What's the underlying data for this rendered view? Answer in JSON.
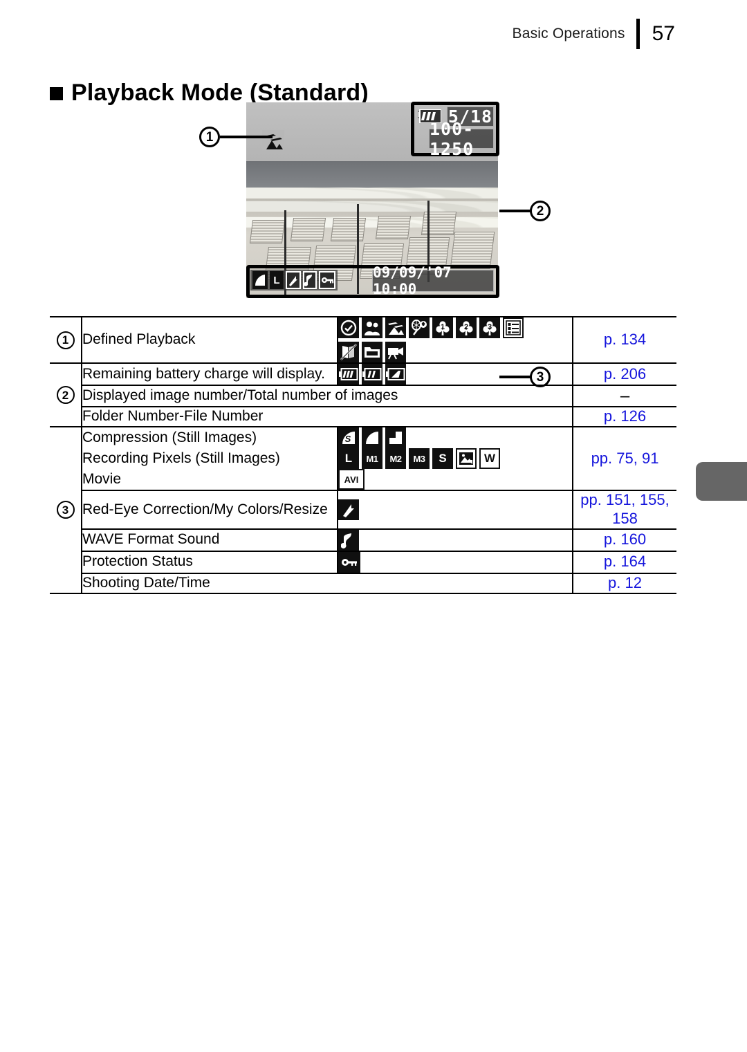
{
  "header": {
    "section": "Basic Operations",
    "page_number": "57"
  },
  "title": "Playback Mode (Standard)",
  "figure": {
    "callouts": [
      "1",
      "2",
      "3"
    ],
    "lcd": {
      "scene_icon": "landscape-scene-icon",
      "battery_icon": "battery-full-icon",
      "image_count": "5/18",
      "folder_file": "100-1250",
      "date_time": "09/09/'07  10:00",
      "status_icons": [
        "compression-fine-icon",
        "recording-pixels-large-icon",
        "red-eye-correction-icon",
        "wave-sound-icon",
        "protection-key-icon"
      ]
    }
  },
  "table": {
    "groups": [
      {
        "callout": "1",
        "rows": [
          {
            "desc": "Defined Playback",
            "icons": [
              {
                "name": "clock-check-icon",
                "label": ""
              },
              {
                "name": "people-portrait-icon",
                "label": ""
              },
              {
                "name": "landscape-icon",
                "label": ""
              },
              {
                "name": "sports-event-icon",
                "label": ""
              },
              {
                "name": "category-club-1-icon",
                "label": "1"
              },
              {
                "name": "category-club-2-icon",
                "label": "2"
              },
              {
                "name": "category-club-3-icon",
                "label": "3"
              },
              {
                "name": "checklist-icon",
                "label": ""
              },
              {
                "name": "no-photo-icon",
                "label": ""
              },
              {
                "name": "folder-icon",
                "label": ""
              },
              {
                "name": "movie-camera-icon",
                "label": ""
              }
            ],
            "page": "p. 134"
          }
        ]
      },
      {
        "callout": "2",
        "rows": [
          {
            "desc": "Remaining battery charge will display.",
            "icons": [
              {
                "name": "battery-full-icon",
                "label": ""
              },
              {
                "name": "battery-half-icon",
                "label": ""
              },
              {
                "name": "battery-low-icon",
                "label": ""
              }
            ],
            "page": "p. 206"
          },
          {
            "desc": "Displayed image number/Total number of images",
            "icons": [],
            "page": "–",
            "full_width": true
          },
          {
            "desc": "Folder Number-File Number",
            "icons": [],
            "page": "p. 126",
            "full_width": true
          }
        ]
      },
      {
        "callout": "3",
        "rows": [
          {
            "desc": "Compression (Still Images)",
            "icons": [
              {
                "name": "compression-superfine-icon",
                "label": "S"
              },
              {
                "name": "compression-fine-icon",
                "label": ""
              },
              {
                "name": "compression-normal-icon",
                "label": ""
              }
            ],
            "page": "pp. 75, 91",
            "page_rowspan": 3
          },
          {
            "desc": "Recording Pixels (Still Images)",
            "icons": [
              {
                "name": "pixels-large-icon",
                "label": "L"
              },
              {
                "name": "pixels-medium1-icon",
                "label": "M1"
              },
              {
                "name": "pixels-medium2-icon",
                "label": "M2"
              },
              {
                "name": "pixels-medium3-icon",
                "label": "M3"
              },
              {
                "name": "pixels-small-icon",
                "label": "S"
              },
              {
                "name": "postcard-datestamp-icon",
                "label": ""
              },
              {
                "name": "pixels-widescreen-icon",
                "label": "W"
              }
            ]
          },
          {
            "desc": "Movie",
            "icons": [
              {
                "name": "movie-avi-icon",
                "label": "AVI"
              }
            ]
          },
          {
            "desc": "Red-Eye Correction/My Colors/Resize",
            "icons": [
              {
                "name": "red-eye-correction-icon",
                "label": ""
              }
            ],
            "page": "pp. 151, 155, 158"
          },
          {
            "desc": "WAVE Format Sound",
            "icons": [
              {
                "name": "wave-sound-icon",
                "label": ""
              }
            ],
            "page": "p. 160"
          },
          {
            "desc": "Protection Status",
            "icons": [
              {
                "name": "protection-key-icon",
                "label": ""
              }
            ],
            "page": "p. 164"
          },
          {
            "desc": "Shooting Date/Time",
            "icons": [],
            "page": "p. 12",
            "full_width": true
          }
        ]
      }
    ]
  },
  "colors": {
    "page_link": "#1414dc",
    "edge_tab": "#666666",
    "text": "#000000"
  }
}
